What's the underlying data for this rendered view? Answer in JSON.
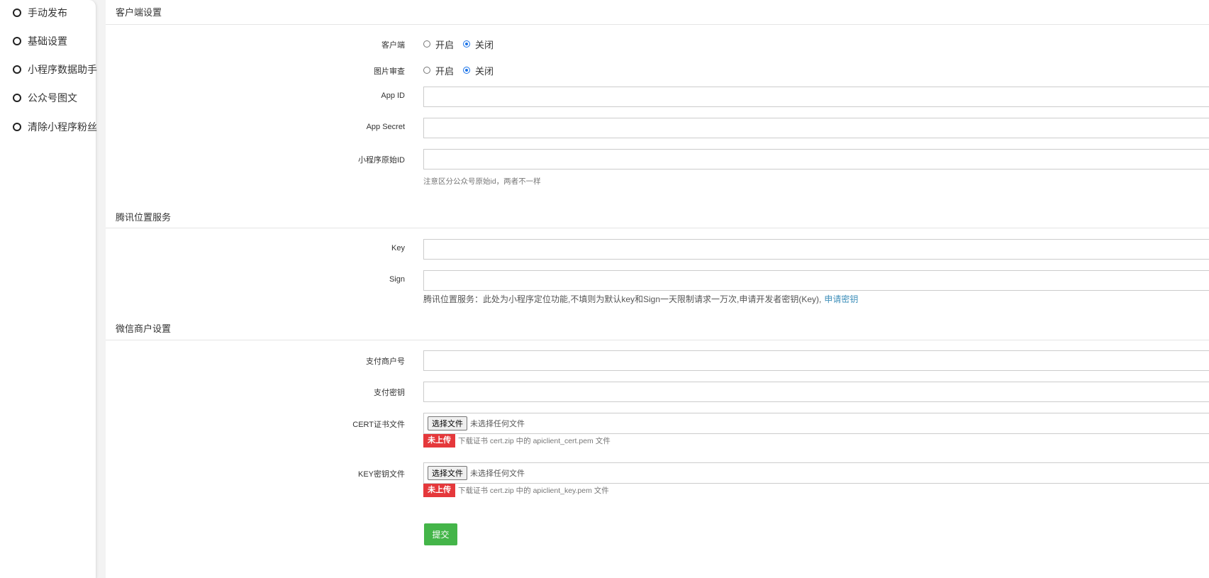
{
  "sidebar": {
    "items": [
      {
        "label": "手动发布"
      },
      {
        "label": "基础设置"
      },
      {
        "label": "小程序数据助手"
      },
      {
        "label": "公众号图文"
      },
      {
        "label": "清除小程序粉丝"
      }
    ]
  },
  "client_section": {
    "title": "客户端设置",
    "client": {
      "label": "客户端",
      "options": [
        "开启",
        "关闭"
      ],
      "selected": "关闭"
    },
    "image_review": {
      "label": "图片审查",
      "options": [
        "开启",
        "关闭"
      ],
      "selected": "关闭"
    },
    "app_id": {
      "label": "App ID",
      "value": ""
    },
    "app_secret": {
      "label": "App Secret",
      "value": ""
    },
    "original_id": {
      "label": "小程序原始ID",
      "value": "",
      "help": "注意区分公众号原始id，两者不一样"
    }
  },
  "tencent_section": {
    "title": "腾讯位置服务",
    "key": {
      "label": "Key",
      "value": ""
    },
    "sign": {
      "label": "Sign",
      "value": ""
    },
    "help": "腾讯位置服务：此处为小程序定位功能,不填则为默认key和Sign一天限制请求一万次,申请开发者密钥(Key),",
    "help_link": "申请密钥"
  },
  "wechat_section": {
    "title": "微信商户设置",
    "merchant_id": {
      "label": "支付商户号",
      "value": ""
    },
    "pay_key": {
      "label": "支付密钥",
      "value": ""
    },
    "cert_file": {
      "label": "CERT证书文件",
      "button": "选择文件",
      "file_text": "未选择任何文件",
      "badge": "未上传",
      "note": "下载证书 cert.zip 中的 apiclient_cert.pem 文件"
    },
    "key_file": {
      "label": "KEY密钥文件",
      "button": "选择文件",
      "file_text": "未选择任何文件",
      "badge": "未上传",
      "note": "下载证书 cert.zip 中的 apiclient_key.pem 文件"
    }
  },
  "submit_label": "提交",
  "colors": {
    "submit": "#44b549",
    "badge": "#e5383b",
    "link": "#3d8eb9",
    "radio_checked": "#1a73e8"
  }
}
